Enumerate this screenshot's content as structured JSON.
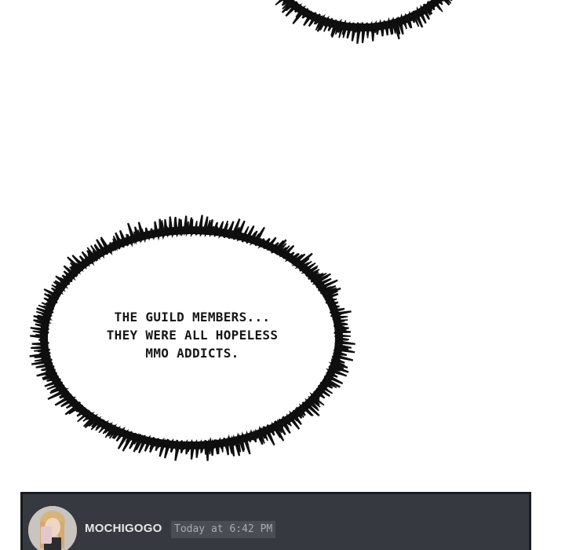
{
  "narration": {
    "lines": [
      "THE GUILD MEMBERS...",
      "THEY WERE ALL HOPELESS",
      "MMO ADDICTS."
    ]
  },
  "chat_message": {
    "username": "MOCHIGOGO",
    "timestamp": "Today at 6:42 PM",
    "avatar_icon": "profile-photo"
  },
  "colors": {
    "page_background": "#ffffff",
    "burst_ink": "#0f0f0f",
    "chat_background": "#36393f",
    "username_text": "#e6e6e6",
    "timestamp_text": "#a9abae"
  }
}
